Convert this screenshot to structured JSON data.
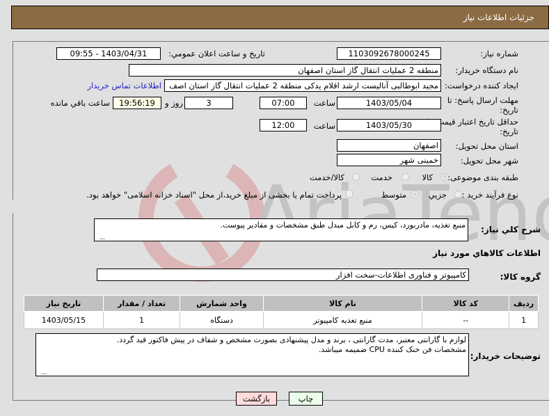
{
  "header": {
    "title": "جزئیات اطلاعات نیاز"
  },
  "form": {
    "need_number": {
      "label": "شماره نیاز:",
      "value": "1103092678000245"
    },
    "announce_datetime": {
      "label": "تاریخ و ساعت اعلان عمومي:",
      "value": "1403/04/31 - 09:55"
    },
    "buyer_org": {
      "label": "نام دستگاه خریدار:",
      "value": "منطقه 2 عملیات انتقال گاز استان اصفهان"
    },
    "requester": {
      "label": "ایجاد کننده درخواست:",
      "value": "مجید ابوطالبی آنالیست ارشد اقلام یدکی منطقه 2 عملیات انتقال گاز استان اصف",
      "contact_link": "اطلاعات تماس خریدار"
    },
    "reply_deadline": {
      "label": "مهلت ارسال پاسخ: تا تاریخ:",
      "date": "1403/05/04",
      "time_label": "ساعت",
      "time": "07:00",
      "days": "3",
      "days_label": "روز و",
      "remaining": "19:56:19",
      "remaining_label": "ساعت باقي مانده"
    },
    "price_validity": {
      "label": "حداقل تاریخ اعتبار قیمت: تا تاریخ:",
      "date": "1403/05/30",
      "time_label": "ساعت",
      "time": "12:00"
    },
    "delivery_province": {
      "label": "استان محل تحویل:",
      "value": "اصفهان"
    },
    "delivery_city": {
      "label": "شهر محل تحویل:",
      "value": "خمینی شهر"
    },
    "category": {
      "label": "طبقه بندی موضوعی:",
      "options": [
        "کالا",
        "خدمت",
        "کالا/خدمت"
      ],
      "selected": "کالا"
    },
    "purchase_type": {
      "label": "نوع فرآیند خرید :",
      "options": [
        "جزیي",
        "متوسط"
      ],
      "selected": "متوسط",
      "payment_note": "پرداخت تمام یا بخشی از مبلغ خرید،از محل \"اسناد خزانه اسلامی\" خواهد بود."
    }
  },
  "description": {
    "label": "شرح كلي نياز:",
    "value": "منبع تغذیه، مادربورد، کیس، رم و کابل مبدل طبق مشخصات و مقادیر پیوست."
  },
  "goods_section": {
    "title": "اطلاعات كالاهاي مورد نياز",
    "group_label": "گروه کالا:",
    "group_value": "کامپیوتر و فناوری اطلاعات-سخت افزار"
  },
  "table": {
    "headers": [
      "ردیف",
      "کد کالا",
      "نام کالا",
      "واحد شمارش",
      "تعداد / مقدار",
      "تاریخ نیاز"
    ],
    "rows": [
      {
        "row": "1",
        "code": "--",
        "name": "منبع تغذیه کامپیوتر",
        "unit": "دستگاه",
        "qty": "1",
        "date": "1403/05/15"
      }
    ]
  },
  "buyer_notes": {
    "label": "توضیحات خریدار:",
    "line1": "لوازم با گارانتی معتبر، مدت گارانتی ، برند و مدل پیشنهادی بصورت مشخص و شفاف در پیش فاکتور قید گردد.",
    "line2": "مشخصات فن خنک کننده CPU ضمیمه میباشد."
  },
  "buttons": {
    "print": "چاپ",
    "back": "بازگشت"
  },
  "colors": {
    "header_bg": "#8b6c42",
    "print_bg": "#eaffea",
    "back_bg": "#ffdada",
    "link": "#2020c0"
  }
}
